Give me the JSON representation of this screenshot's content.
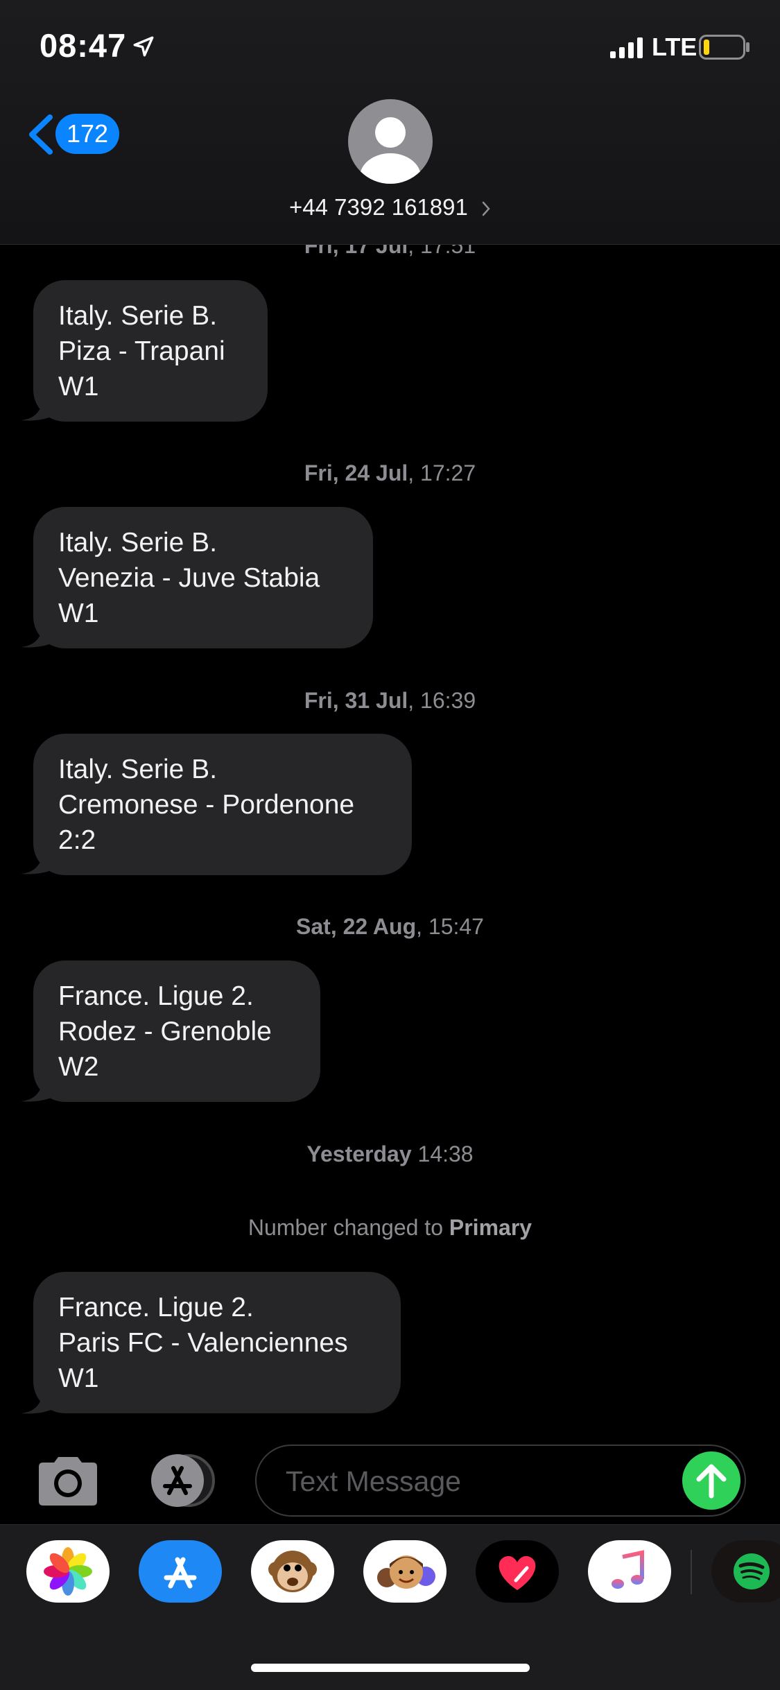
{
  "status_bar": {
    "time": "08:47",
    "carrier": "LTE"
  },
  "header": {
    "back_count": "172",
    "contact": "+44 7392 161891"
  },
  "top_partial_timestamp": {
    "date": "Fri, 17 Jul",
    "time": ", 17:51"
  },
  "messages": [
    {
      "lines": [
        "Italy. Serie B.",
        "Piza - Trapani",
        "W1"
      ]
    },
    {
      "date": "Fri, 24 Jul",
      "time": ", 17:27",
      "lines": [
        "Italy. Serie B.",
        "Venezia - Juve Stabia",
        "W1"
      ]
    },
    {
      "date": "Fri, 31 Jul",
      "time": ", 16:39",
      "lines": [
        "Italy. Serie B.",
        "Cremonese - Pordenone",
        "2:2"
      ]
    },
    {
      "date": "Sat, 22 Aug",
      "time": ", 15:47",
      "lines": [
        "France. Ligue 2.",
        "Rodez - Grenoble",
        "W2"
      ]
    },
    {
      "date": "Yesterday",
      "time": " 14:38",
      "lines": [
        "France. Ligue 2.",
        "Paris FC - Valenciennes",
        "W1"
      ]
    }
  ],
  "note": {
    "prefix": "Number changed to ",
    "value": "Primary"
  },
  "composer": {
    "placeholder": "Text Message"
  },
  "app_drawer": {
    "apps": [
      "photos-app-icon",
      "app-store-app-icon",
      "animoji-app-icon",
      "memoji-app-icon",
      "digital-touch-app-icon",
      "music-app-icon",
      "spotify-app-icon"
    ]
  },
  "colors": {
    "accent": "#0a84ff",
    "bubble": "#262628",
    "send": "#30d158"
  }
}
